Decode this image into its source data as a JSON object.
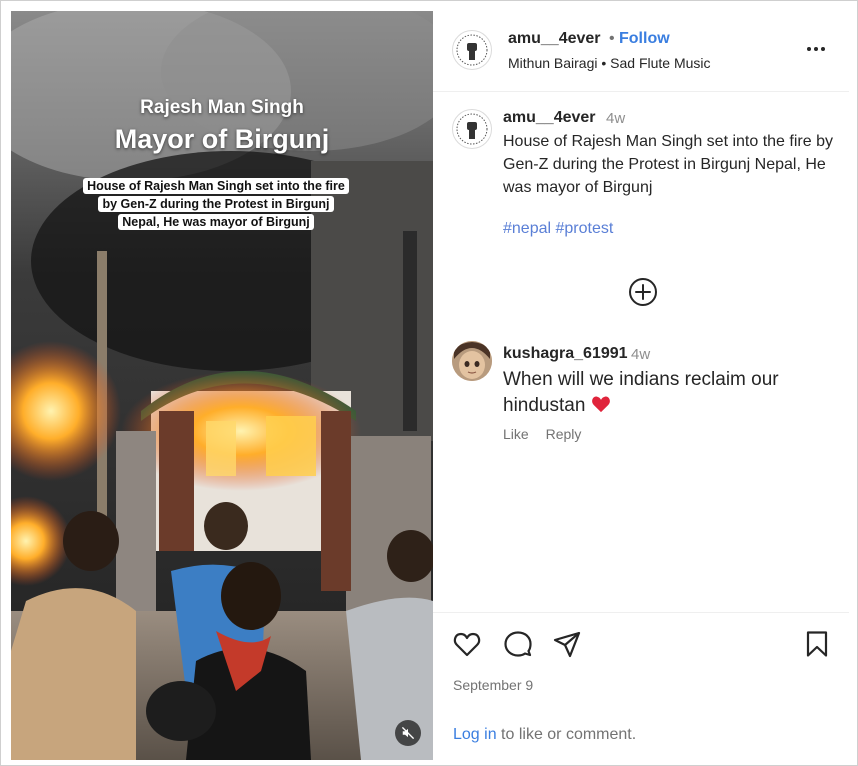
{
  "media": {
    "title_line1": "Rajesh Man Singh",
    "title_line2": "Mayor of Birgunj",
    "caption_overlay": "House of Rajesh Man Singh set into the fire by Gen-Z during the Protest in Birgunj Nepal, He was mayor of Birgunj",
    "mute_icon": "speaker-muted-icon"
  },
  "header": {
    "username": "amu__4ever",
    "separator": "•",
    "follow_label": "Follow",
    "music": "Mithun Bairagi • Sad Flute Music",
    "more_icon": "more-options-icon"
  },
  "caption": {
    "username": "amu__4ever",
    "time": "4w",
    "text": "House of Rajesh Man Singh set into the fire by Gen-Z during the Protest in Birgunj Nepal, He was mayor of Birgunj",
    "hashtags": [
      "#nepal",
      "#protest"
    ]
  },
  "load_more_icon": "plus-circle-icon",
  "comment": {
    "username": "kushagra_61991",
    "time": "4w",
    "text": "When will we indians reclaim our hindustan",
    "emoji": "❤️",
    "like_label": "Like",
    "reply_label": "Reply"
  },
  "actions": {
    "icons": [
      "heart-icon",
      "comment-icon",
      "share-icon",
      "bookmark-icon"
    ],
    "date": "September 9",
    "login_link": "Log in",
    "login_suffix": " to like or comment."
  },
  "colors": {
    "link_blue": "#3a7ee0",
    "hashtag_blue": "#5a7fd6",
    "heart_red": "#e0243b",
    "text": "#262626",
    "muted": "#8e8e8e"
  }
}
